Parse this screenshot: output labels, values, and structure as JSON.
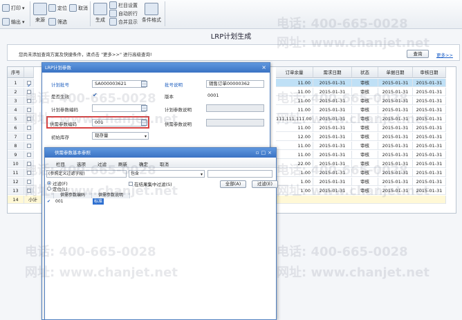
{
  "toolbar": {
    "print": "打印",
    "output": "输出",
    "source": "来源",
    "locate": "定位",
    "filter": "筛选",
    "cancel": "取消",
    "generate": "生成",
    "column_settings": "栏目设置",
    "auto_fold": "自动折行",
    "merge_display": "合并显示",
    "condition_format": "条件格式"
  },
  "page": {
    "title": "LRP计划生成",
    "hint": "您尚未添加查询方案及快捷条件，请点击 \"更多>>\" 进行高级查询!",
    "query_button": "查询",
    "more_link": "更多>>"
  },
  "grid": {
    "headers": [
      "序号",
      "",
      "订单余量",
      "需求日期",
      "状态",
      "单据日期",
      "审核日期"
    ],
    "rows": [
      {
        "no": "1",
        "qty": "11.00",
        "need": "2015-01-31",
        "status": "审核",
        "doc": "2015-01-31",
        "audit": "2015-01-31",
        "checked": true,
        "selected": true
      },
      {
        "no": "2",
        "qty": "11.00",
        "need": "2015-01-31",
        "status": "审核",
        "doc": "2015-01-31",
        "audit": "2015-01-31"
      },
      {
        "no": "3",
        "qty": "11.00",
        "need": "2015-01-31",
        "status": "审核",
        "doc": "2015-01-31",
        "audit": "2015-01-31"
      },
      {
        "no": "4",
        "qty": "11.00",
        "need": "2015-01-31",
        "status": "审核",
        "doc": "2015-01-31",
        "audit": "2015-01-31"
      },
      {
        "no": "5",
        "qty": "111,111,111.00",
        "need": "2015-01-31",
        "status": "审核",
        "doc": "2015-01-31",
        "audit": "2015-01-31"
      },
      {
        "no": "6",
        "qty": "11.00",
        "need": "2015-01-31",
        "status": "审核",
        "doc": "2015-01-31",
        "audit": "2015-01-31"
      },
      {
        "no": "7",
        "qty": "12.00",
        "need": "2015-01-31",
        "status": "审核",
        "doc": "2015-01-31",
        "audit": "2015-01-31"
      },
      {
        "no": "8",
        "qty": "11.00",
        "need": "2015-01-31",
        "status": "审核",
        "doc": "2015-01-31",
        "audit": "2015-01-31"
      },
      {
        "no": "9",
        "qty": "11.00",
        "need": "2015-01-31",
        "status": "审核",
        "doc": "2015-01-31",
        "audit": "2015-01-31"
      },
      {
        "no": "10",
        "qty": "22.00",
        "need": "2015-01-31",
        "status": "审核",
        "doc": "2015-01-31",
        "audit": "2015-01-31"
      },
      {
        "no": "11",
        "qty": "1.00",
        "need": "2015-01-31",
        "status": "审核",
        "doc": "2015-01-31",
        "audit": "2015-01-31"
      },
      {
        "no": "12",
        "qty": "1.00",
        "need": "2015-01-31",
        "status": "审核",
        "doc": "2015-01-31",
        "audit": "2015-01-31"
      },
      {
        "no": "13",
        "qty": "1.00",
        "need": "2015-01-31",
        "status": "审核",
        "doc": "2015-01-31",
        "audit": "2015-01-31"
      }
    ],
    "total_row": {
      "no": "14",
      "label": "小计"
    }
  },
  "dialog1": {
    "title": "LRP计划参数",
    "plan_no_label": "计划批号",
    "plan_no_value": "SA000003621",
    "batch_desc_label": "批号说明",
    "batch_desc_value": "销售订单00000362",
    "replenish_label": "是否生效",
    "version_label": "版本",
    "version_value": "0001",
    "plan_param_code_label": "计划参数编码",
    "plan_param_desc_label": "计划参数说明",
    "supply_param_code_label": "供需参数编码",
    "supply_param_code_value": "001",
    "supply_param_desc_label": "供需参数说明",
    "initial_inventory_label": "初始库存",
    "initial_inventory_value": "现存量"
  },
  "dialog2": {
    "title": "供需参数基本参照",
    "tool_columns": "栏目",
    "tool_options": "选项",
    "tool_filter": "过滤",
    "tool_refresh": "刷新",
    "tool_confirm": "确定",
    "tool_cancel": "取消",
    "field_select": "(参照定义过滤字段)",
    "op_select": "包含",
    "radio_filter": "过滤(F)",
    "radio_locate": "定位(L)",
    "filter_in_result": "在结果集中过滤(S)",
    "all_button": "全部(A)",
    "filter_button": "过滤(E)",
    "col_code": "供需参数编码",
    "col_desc": "供需参数说明",
    "row_code": "001",
    "row_desc": "标准"
  },
  "watermark": {
    "phone": "电话: 400-665-0028",
    "site": "网址: www.chanjet.net"
  }
}
